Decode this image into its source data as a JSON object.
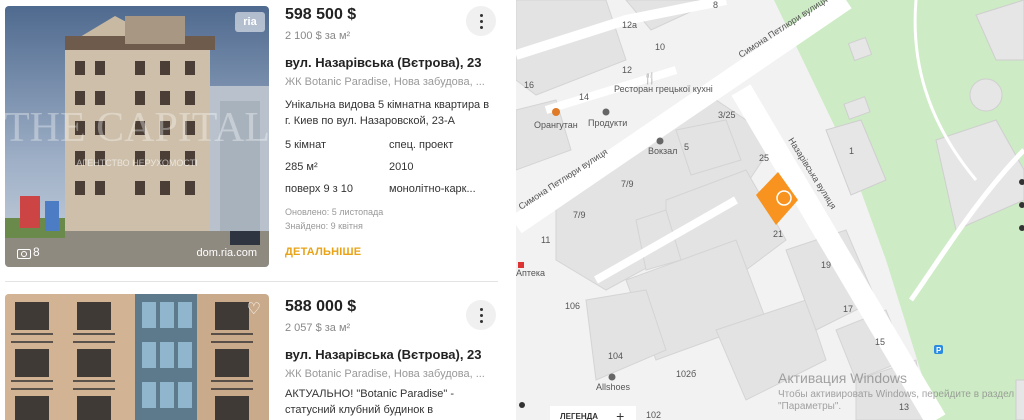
{
  "listings": [
    {
      "price": "598 500 $",
      "price_per_m2": "2 100 $ за м²",
      "street": "вул. Назарівська (Вєтрова), 23",
      "complex": "ЖК Botanic Paradise, Нова забудова, ...",
      "description": "Унікальна видова 5 кімнатна квартира в г. Киев по вул. Назаровской, 23-А",
      "props": [
        "5 кімнат",
        "спец. проект",
        "285 м²",
        "2010",
        "поверх 9 з 10",
        "монолітно-карк..."
      ],
      "updated": "Оновлено: 5 листопада",
      "found": "Знайдено: 9 квітня",
      "more_label": "ДЕТАЛЬНІШЕ",
      "photo_count": "8",
      "photo_source": "dom.ria.com",
      "photo_badge": "ria",
      "watermark_big": "THE CAPITAL",
      "watermark_small": "АГЕНТСТВО НЕРУХОМОСТІ"
    },
    {
      "price": "588 000 $",
      "price_per_m2": "2 057 $ за м²",
      "street": "вул. Назарівська (Вєтрова), 23",
      "complex": "ЖК Botanic Paradise, Нова забудова, ...",
      "description": "АКТУАЛЬНО! \"Botanic Paradise\" - статусний клубний будинок в історичний"
    }
  ],
  "map": {
    "streets": [
      "Симона Петлюри вулиця",
      "Симона Петлюри вулиця",
      "Назарівська вулиця"
    ],
    "building_numbers": [
      "8",
      "12а",
      "10",
      "16",
      "14",
      "12",
      "3/25",
      "5",
      "25",
      "1",
      "7/9",
      "7/9",
      "11",
      "21",
      "19",
      "17",
      "106",
      "15",
      "104",
      "102б",
      "13",
      "102"
    ],
    "pois": [
      "Ресторан грецької кухні",
      "Орангутан",
      "Продукти",
      "Вокзал",
      "Allshoes",
      "Аптека"
    ],
    "legend_label": "ЛЕГЕНДА",
    "zoom_in": "+",
    "parking_label": "P",
    "marker_color": "#f7931e",
    "park_color": "#cdebc4",
    "watermark_title": "Активация Windows",
    "watermark_text": "Чтобы активировать Windows, перейдите в раздел \"Параметры\"."
  }
}
